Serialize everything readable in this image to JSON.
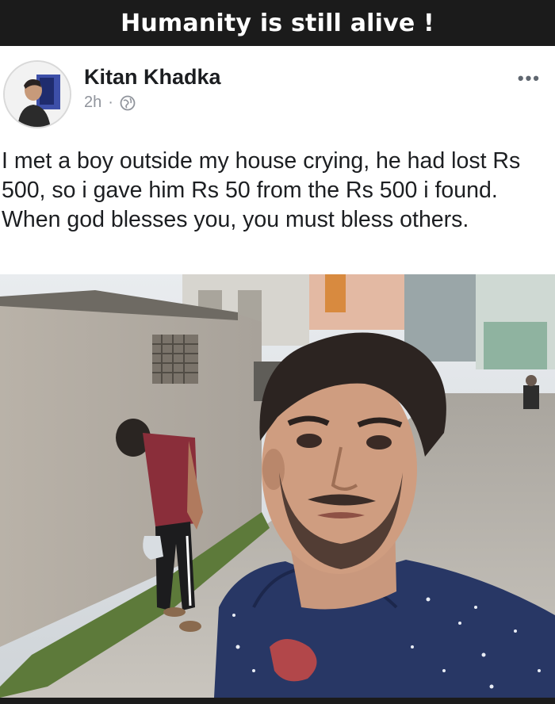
{
  "header": {
    "title": "Humanity is still alive !"
  },
  "post": {
    "author": "Kitan Khadka",
    "time": "2h",
    "separator": "·",
    "privacy_icon": "globe-icon",
    "more_icon": "more-options-icon",
    "more_label": "•••",
    "text": "I met a boy outside my house crying, he had lost Rs 500, so i gave him Rs 50 from the Rs 500 i found. When god blesses you, you must bless others."
  },
  "colors": {
    "header_bg": "#1b1b1b",
    "card_bg": "#ffffff",
    "text": "#1c1e21",
    "meta": "#90949c"
  }
}
